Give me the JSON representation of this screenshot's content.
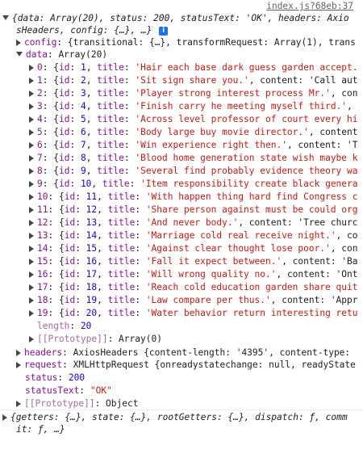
{
  "source_link": "index.js?68eb:37",
  "response": {
    "summary_line1": "{data: Array(20), status: 200, statusText: 'OK', headers: Axio",
    "summary_line2": "sHeaders, config: {…}, …}",
    "info_badge": "i",
    "config": {
      "key": "config",
      "value": "{transitional: {…}, transformRequest: Array(1), trans"
    },
    "data": {
      "key": "data",
      "value": "Array(20)",
      "items": [
        {
          "index": "0",
          "id": "1",
          "title": "'Hair each base dark guess garden accept.",
          "rest": ""
        },
        {
          "index": "1",
          "id": "2",
          "title": "'Sit sign share you.'",
          "rest": ", content: 'Call aut"
        },
        {
          "index": "2",
          "id": "3",
          "title": "'Player strong interest process Mr.'",
          "rest": ", con"
        },
        {
          "index": "3",
          "id": "4",
          "title": "'Finish carry he meeting myself third.'",
          "rest": ","
        },
        {
          "index": "4",
          "id": "5",
          "title": "'Across level professor of court every hi",
          "rest": ""
        },
        {
          "index": "5",
          "id": "6",
          "title": "'Body large buy movie director.'",
          "rest": ", content"
        },
        {
          "index": "6",
          "id": "7",
          "title": "'Win experience right then.'",
          "rest": ", content: 'T"
        },
        {
          "index": "7",
          "id": "8",
          "title": "'Blood home generation state wish maybe k",
          "rest": ""
        },
        {
          "index": "8",
          "id": "9",
          "title": "'Several find probably evidence theory wa",
          "rest": ""
        },
        {
          "index": "9",
          "id": "10",
          "title": "'Item responsibility create black genera",
          "rest": ""
        },
        {
          "index": "10",
          "id": "11",
          "title": "'With happen thing hard find Congress c",
          "rest": ""
        },
        {
          "index": "11",
          "id": "12",
          "title": "'Share person against must be could org",
          "rest": ""
        },
        {
          "index": "12",
          "id": "13",
          "title": "'And never body.'",
          "rest": ", content: 'Tree churc"
        },
        {
          "index": "13",
          "id": "14",
          "title": "'Marriage cold real receive night.'",
          "rest": ", co"
        },
        {
          "index": "14",
          "id": "15",
          "title": "'Against clear thought lose poor.'",
          "rest": ", con"
        },
        {
          "index": "15",
          "id": "16",
          "title": "'Fall it expect between.'",
          "rest": ", content: 'Ba"
        },
        {
          "index": "16",
          "id": "17",
          "title": "'Will wrong quality no.'",
          "rest": ", content: 'Ont"
        },
        {
          "index": "17",
          "id": "18",
          "title": "'Reach cold education garden share quit",
          "rest": ""
        },
        {
          "index": "18",
          "id": "19",
          "title": "'Law compare per thus.'",
          "rest": ", content: 'Appr"
        },
        {
          "index": "19",
          "id": "20",
          "title": "'Water behavior return interesting retu",
          "rest": ""
        }
      ],
      "length_key": "length",
      "length_value": "20",
      "prototype_key": "[[Prototype]]",
      "prototype_value": "Array(0)"
    },
    "headers": {
      "key": "headers",
      "value": "AxiosHeaders {content-length: '4395', content-type:"
    },
    "request": {
      "key": "request",
      "value": "XMLHttpRequest {onreadystatechange: null, readyState"
    },
    "status": {
      "key": "status",
      "value": "200"
    },
    "statusText": {
      "key": "statusText",
      "value": "\"OK\""
    },
    "prototype": {
      "key": "[[Prototype]]",
      "value": "Object"
    }
  },
  "store": {
    "line1": "{getters: {…}, state: {…}, rootGetters: {…}, dispatch: ƒ, comm",
    "line2": "it: ƒ, …}"
  }
}
